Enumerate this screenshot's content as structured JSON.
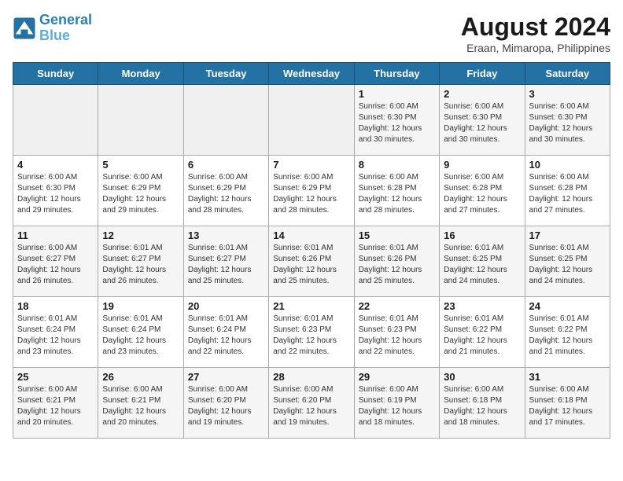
{
  "header": {
    "logo_line1": "General",
    "logo_line2": "Blue",
    "title": "August 2024",
    "subtitle": "Eraan, Mimaropa, Philippines"
  },
  "days_of_week": [
    "Sunday",
    "Monday",
    "Tuesday",
    "Wednesday",
    "Thursday",
    "Friday",
    "Saturday"
  ],
  "weeks": [
    [
      {
        "day": "",
        "info": ""
      },
      {
        "day": "",
        "info": ""
      },
      {
        "day": "",
        "info": ""
      },
      {
        "day": "",
        "info": ""
      },
      {
        "day": "1",
        "info": "Sunrise: 6:00 AM\nSunset: 6:30 PM\nDaylight: 12 hours\nand 30 minutes."
      },
      {
        "day": "2",
        "info": "Sunrise: 6:00 AM\nSunset: 6:30 PM\nDaylight: 12 hours\nand 30 minutes."
      },
      {
        "day": "3",
        "info": "Sunrise: 6:00 AM\nSunset: 6:30 PM\nDaylight: 12 hours\nand 30 minutes."
      }
    ],
    [
      {
        "day": "4",
        "info": "Sunrise: 6:00 AM\nSunset: 6:30 PM\nDaylight: 12 hours\nand 29 minutes."
      },
      {
        "day": "5",
        "info": "Sunrise: 6:00 AM\nSunset: 6:29 PM\nDaylight: 12 hours\nand 29 minutes."
      },
      {
        "day": "6",
        "info": "Sunrise: 6:00 AM\nSunset: 6:29 PM\nDaylight: 12 hours\nand 28 minutes."
      },
      {
        "day": "7",
        "info": "Sunrise: 6:00 AM\nSunset: 6:29 PM\nDaylight: 12 hours\nand 28 minutes."
      },
      {
        "day": "8",
        "info": "Sunrise: 6:00 AM\nSunset: 6:28 PM\nDaylight: 12 hours\nand 28 minutes."
      },
      {
        "day": "9",
        "info": "Sunrise: 6:00 AM\nSunset: 6:28 PM\nDaylight: 12 hours\nand 27 minutes."
      },
      {
        "day": "10",
        "info": "Sunrise: 6:00 AM\nSunset: 6:28 PM\nDaylight: 12 hours\nand 27 minutes."
      }
    ],
    [
      {
        "day": "11",
        "info": "Sunrise: 6:00 AM\nSunset: 6:27 PM\nDaylight: 12 hours\nand 26 minutes."
      },
      {
        "day": "12",
        "info": "Sunrise: 6:01 AM\nSunset: 6:27 PM\nDaylight: 12 hours\nand 26 minutes."
      },
      {
        "day": "13",
        "info": "Sunrise: 6:01 AM\nSunset: 6:27 PM\nDaylight: 12 hours\nand 25 minutes."
      },
      {
        "day": "14",
        "info": "Sunrise: 6:01 AM\nSunset: 6:26 PM\nDaylight: 12 hours\nand 25 minutes."
      },
      {
        "day": "15",
        "info": "Sunrise: 6:01 AM\nSunset: 6:26 PM\nDaylight: 12 hours\nand 25 minutes."
      },
      {
        "day": "16",
        "info": "Sunrise: 6:01 AM\nSunset: 6:25 PM\nDaylight: 12 hours\nand 24 minutes."
      },
      {
        "day": "17",
        "info": "Sunrise: 6:01 AM\nSunset: 6:25 PM\nDaylight: 12 hours\nand 24 minutes."
      }
    ],
    [
      {
        "day": "18",
        "info": "Sunrise: 6:01 AM\nSunset: 6:24 PM\nDaylight: 12 hours\nand 23 minutes."
      },
      {
        "day": "19",
        "info": "Sunrise: 6:01 AM\nSunset: 6:24 PM\nDaylight: 12 hours\nand 23 minutes."
      },
      {
        "day": "20",
        "info": "Sunrise: 6:01 AM\nSunset: 6:24 PM\nDaylight: 12 hours\nand 22 minutes."
      },
      {
        "day": "21",
        "info": "Sunrise: 6:01 AM\nSunset: 6:23 PM\nDaylight: 12 hours\nand 22 minutes."
      },
      {
        "day": "22",
        "info": "Sunrise: 6:01 AM\nSunset: 6:23 PM\nDaylight: 12 hours\nand 22 minutes."
      },
      {
        "day": "23",
        "info": "Sunrise: 6:01 AM\nSunset: 6:22 PM\nDaylight: 12 hours\nand 21 minutes."
      },
      {
        "day": "24",
        "info": "Sunrise: 6:01 AM\nSunset: 6:22 PM\nDaylight: 12 hours\nand 21 minutes."
      }
    ],
    [
      {
        "day": "25",
        "info": "Sunrise: 6:00 AM\nSunset: 6:21 PM\nDaylight: 12 hours\nand 20 minutes."
      },
      {
        "day": "26",
        "info": "Sunrise: 6:00 AM\nSunset: 6:21 PM\nDaylight: 12 hours\nand 20 minutes."
      },
      {
        "day": "27",
        "info": "Sunrise: 6:00 AM\nSunset: 6:20 PM\nDaylight: 12 hours\nand 19 minutes."
      },
      {
        "day": "28",
        "info": "Sunrise: 6:00 AM\nSunset: 6:20 PM\nDaylight: 12 hours\nand 19 minutes."
      },
      {
        "day": "29",
        "info": "Sunrise: 6:00 AM\nSunset: 6:19 PM\nDaylight: 12 hours\nand 18 minutes."
      },
      {
        "day": "30",
        "info": "Sunrise: 6:00 AM\nSunset: 6:18 PM\nDaylight: 12 hours\nand 18 minutes."
      },
      {
        "day": "31",
        "info": "Sunrise: 6:00 AM\nSunset: 6:18 PM\nDaylight: 12 hours\nand 17 minutes."
      }
    ]
  ]
}
